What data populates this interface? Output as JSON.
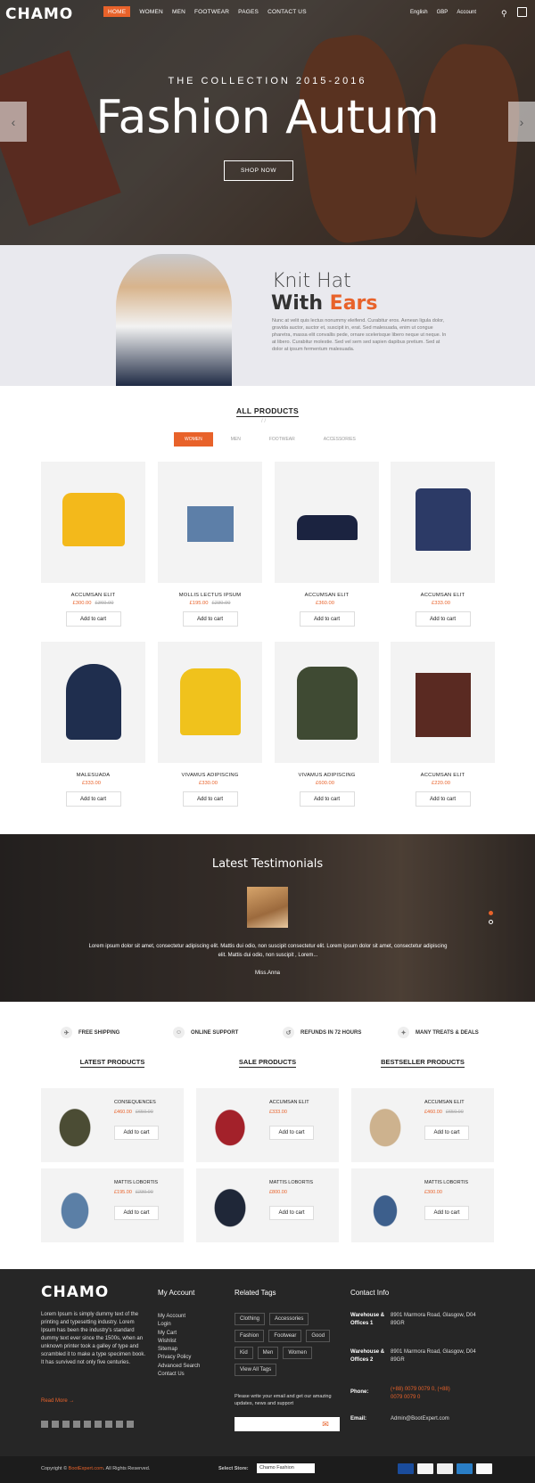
{
  "header": {
    "logo": "CHAMO",
    "menu": [
      "HOME",
      "WOMEN",
      "MEN",
      "FOOTWEAR",
      "PAGES",
      "CONTACT US"
    ],
    "right": [
      "English",
      "GBP",
      "Account"
    ]
  },
  "hero": {
    "kicker": "THE COLLECTION 2015-2016",
    "title": "Fashion Autum",
    "button": "SHOP NOW",
    "prev": "‹",
    "next": "›"
  },
  "banner": {
    "line1": "Knit Hat",
    "line2a": "With",
    "line2b": "Ears",
    "text": "Nunc at velit quis lectus nonummy eleifend. Curabitur eros. Aenean ligula dolor, gravida auctor, auctor et, suscipit in, erat. Sed malesuada, enim ut congue pharetra, massa elit convallis pede, ornare scelerisque libero neque ut neque. In at libero. Curabitur molestie. Sed vel sem sed sapien dapibus pretium. Sed at dolor at ipsum fermentum malesuada."
  },
  "all_products": {
    "title": "ALL PRODUCTS",
    "tabs": [
      "WOMEN",
      "MEN",
      "FOOTWEAR",
      "ACCESSORIES"
    ],
    "items": [
      {
        "name": "ACCUMSAN ELIT",
        "price": "£300.00",
        "old": "£360.00",
        "btn": "Add to cart"
      },
      {
        "name": "MOLLIS LECTUS IPSUM",
        "price": "£195.00",
        "old": "£230.00",
        "btn": "Add to cart"
      },
      {
        "name": "ACCUMSAN ELIT",
        "price": "£360.00",
        "old": "",
        "btn": "Add to cart"
      },
      {
        "name": "ACCUMSAN ELIT",
        "price": "£333.00",
        "old": "",
        "btn": "Add to cart"
      },
      {
        "name": "MALESUADA",
        "price": "£333.00",
        "old": "",
        "btn": "Add to cart"
      },
      {
        "name": "VIVAMUS ADIPISCING",
        "price": "£330.00",
        "old": "",
        "btn": "Add to cart"
      },
      {
        "name": "VIVAMUS ADIPISCING",
        "price": "£600.00",
        "old": "",
        "btn": "Add to cart"
      },
      {
        "name": "ACCUMSAN ELIT",
        "price": "£220.00",
        "old": "",
        "btn": "Add to cart"
      }
    ]
  },
  "testimonials": {
    "title": "Latest Testimonials",
    "text": "Lorem ipsum dolor sit amet, consectetur adipiscing elit. Mattis dui odio, non suscipit consectetur elit. Lorem ipsum dolor sit amet, consectetur adipiscing elit. Mattis dui odio, non suscipit , Lorem...",
    "name": "Miss.Anna"
  },
  "features": [
    "FREE SHIPPING",
    "ONLINE SUPPORT",
    "REFUNDS IN 72 HOURS",
    "MANY TREATS & DEALS"
  ],
  "columns": [
    {
      "title": "LATEST PRODUCTS",
      "items": [
        {
          "name": "CONSEQUENCES",
          "price": "£460.00",
          "old": "£650.00",
          "btn": "Add to cart"
        },
        {
          "name": "MATTIS LOBORTIS",
          "price": "£195.00",
          "old": "£230.00",
          "btn": "Add to cart"
        }
      ]
    },
    {
      "title": "SALE PRODUCTS",
      "items": [
        {
          "name": "ACCUMSAN ELIT",
          "price": "£333.00",
          "old": "",
          "btn": "Add to cart"
        },
        {
          "name": "MATTIS LOBORTIS",
          "price": "£800.00",
          "old": "",
          "btn": "Add to cart"
        }
      ]
    },
    {
      "title": "BESTSELLER PRODUCTS",
      "items": [
        {
          "name": "ACCUMSAN ELIT",
          "price": "£460.00",
          "old": "£650.00",
          "btn": "Add to cart"
        },
        {
          "name": "MATTIS LOBORTIS",
          "price": "£300.00",
          "old": "",
          "btn": "Add to cart"
        }
      ]
    }
  ],
  "footer": {
    "logo": "CHAMO",
    "about": "Lorem Ipsum is simply dummy text of the printing and typesetting industry. Lorem Ipsum has been the industry's standard dummy text ever since the 1500s, when an unknown printer took a galley of type and scrambled it to make a type specimen book. It has survived not only five centuries.",
    "readmore": "Read More →",
    "account_title": "My Account",
    "account_links": [
      "My Account",
      "Login",
      "My Cart",
      "Wishlist",
      "Sitemap",
      "Privacy Policy",
      "Advanced Search",
      "Contact Us"
    ],
    "tags_title": "Related Tags",
    "tags": [
      "Clothing",
      "Accessories",
      "Fashion",
      "Footwear",
      "Good",
      "Kid",
      "Men",
      "Women",
      "View All Tags"
    ],
    "newsletter": "Please write your email and get our amazing updates, news and support",
    "contact_title": "Contact Info",
    "contact": [
      {
        "label": "Warehouse & Offices 1",
        "value": "8901 Marmora Road, Glasgow, D04 89GR"
      },
      {
        "label": "Warehouse & Offices 2",
        "value": "8901 Marmora Road, Glasgow, D04 89GR"
      },
      {
        "label": "Phone:",
        "value": "(+88) 0079 0079 0, (+88) 0079 0079 0"
      },
      {
        "label": "Email:",
        "value": "Admin@BootExpert.com"
      }
    ]
  },
  "bottom": {
    "copy_a": "Copyright ©",
    "copy_b": "BootExpert.com",
    "copy_c": ". All Rights Reserved.",
    "store_label": "Select Store:",
    "store_value": "Chamo Fashion"
  }
}
